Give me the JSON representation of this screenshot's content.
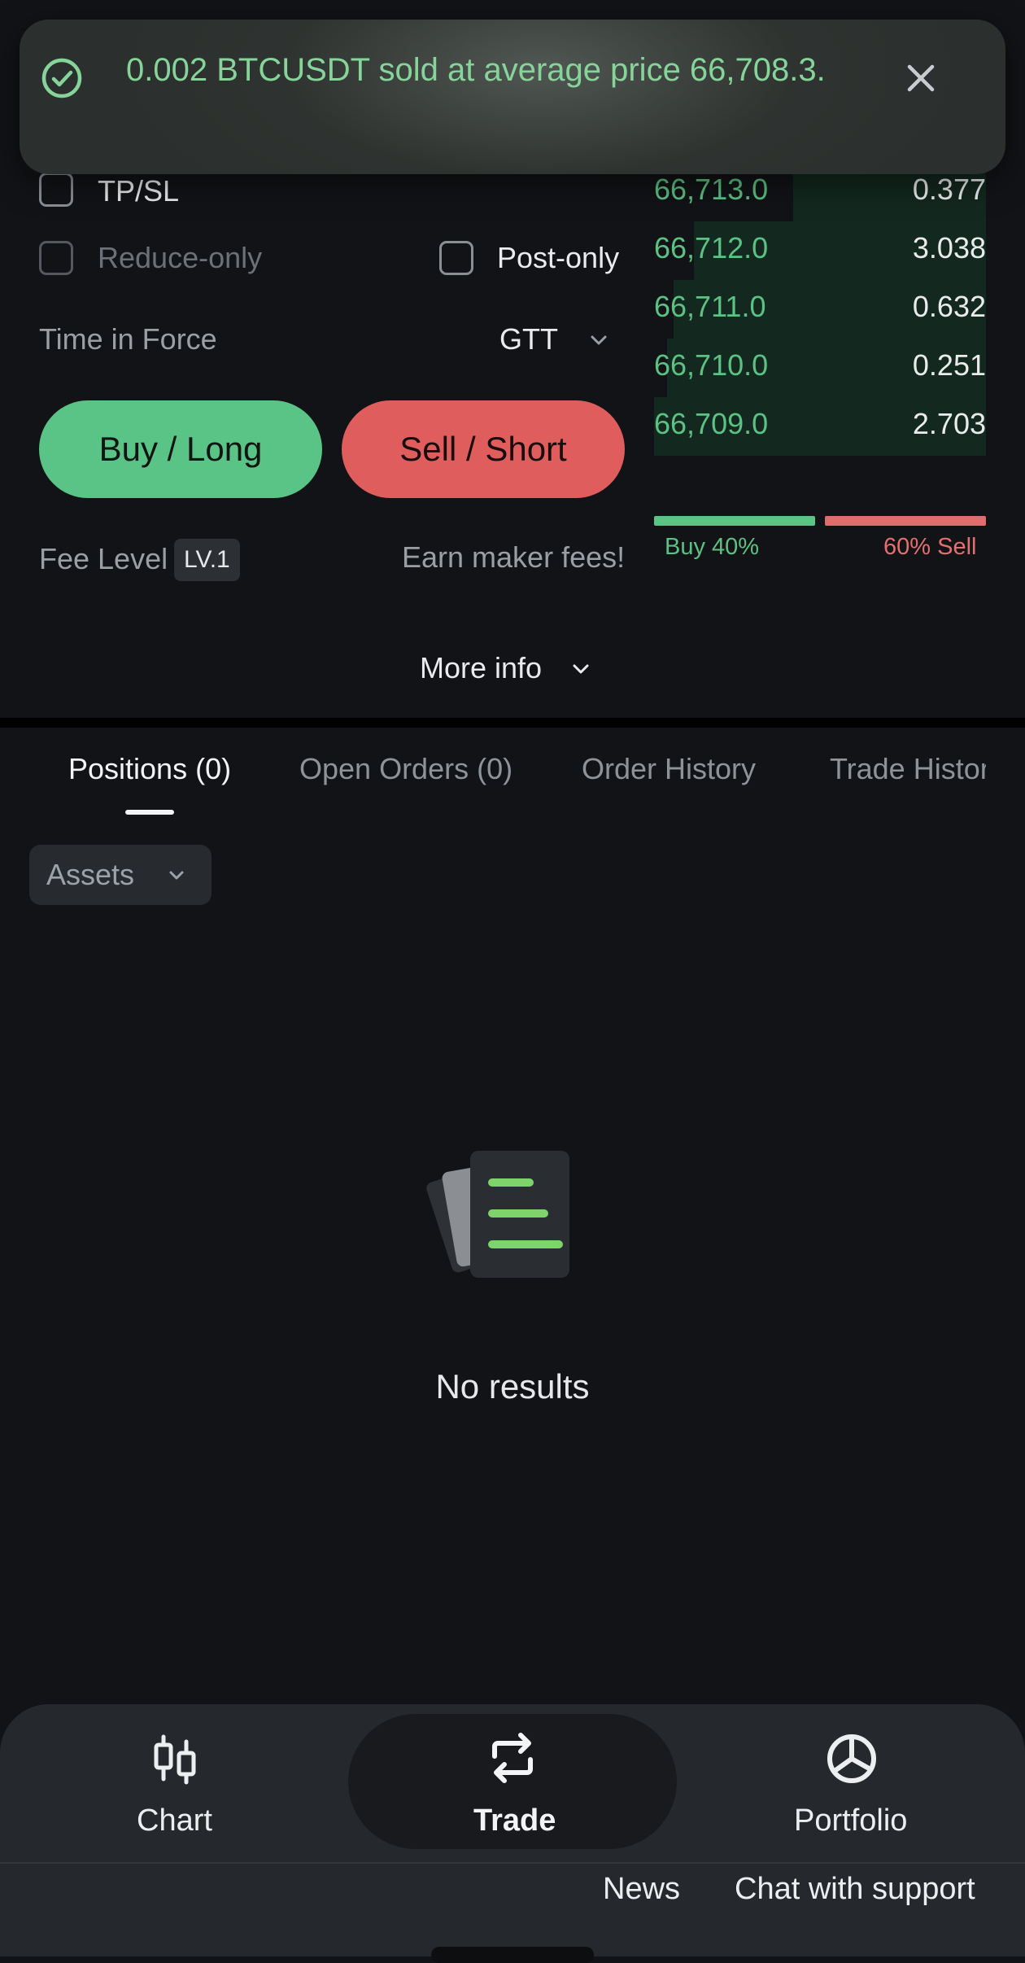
{
  "toast": {
    "message": "0.002 BTCUSDT sold at average price 66,708.3.",
    "icon_check": "check-circle-icon",
    "icon_close": "close-icon"
  },
  "order_form": {
    "tpsl_label": "TP/SL",
    "reduce_only_label": "Reduce-only",
    "post_only_label": "Post-only",
    "time_in_force_label": "Time in Force",
    "time_in_force_value": "GTT",
    "buy_label": "Buy / Long",
    "sell_label": "Sell / Short",
    "fee_level_label": "Fee Level",
    "fee_level_badge": "LV.1",
    "maker_fees_text": "Earn maker fees!"
  },
  "order_book": {
    "rows": [
      {
        "price": "66,713.0",
        "qty": "0.377",
        "depth": 0.58
      },
      {
        "price": "66,712.0",
        "qty": "3.038",
        "depth": 0.88
      },
      {
        "price": "66,711.0",
        "qty": "0.632",
        "depth": 0.94
      },
      {
        "price": "66,710.0",
        "qty": "0.251",
        "depth": 0.96
      },
      {
        "price": "66,709.0",
        "qty": "2.703",
        "depth": 1.0
      }
    ],
    "buy_ratio_label": "Buy 40%",
    "sell_ratio_label": "60% Sell",
    "buy_ratio": 0.4,
    "sell_ratio": 0.6
  },
  "more_info_label": "More info",
  "tabs": [
    {
      "label": "Positions (0)",
      "active": true
    },
    {
      "label": "Open Orders (0)",
      "active": false
    },
    {
      "label": "Order History",
      "active": false
    },
    {
      "label": "Trade Histor",
      "active": false
    }
  ],
  "assets_filter": "Assets",
  "empty_state": "No results",
  "bottom_nav": {
    "chart_label": "Chart",
    "trade_label": "Trade",
    "portfolio_label": "Portfolio",
    "news_label": "News",
    "support_label": "Chat with support"
  },
  "colors": {
    "buy": "#5ac386",
    "sell": "#df5d5d",
    "background": "#121316"
  }
}
